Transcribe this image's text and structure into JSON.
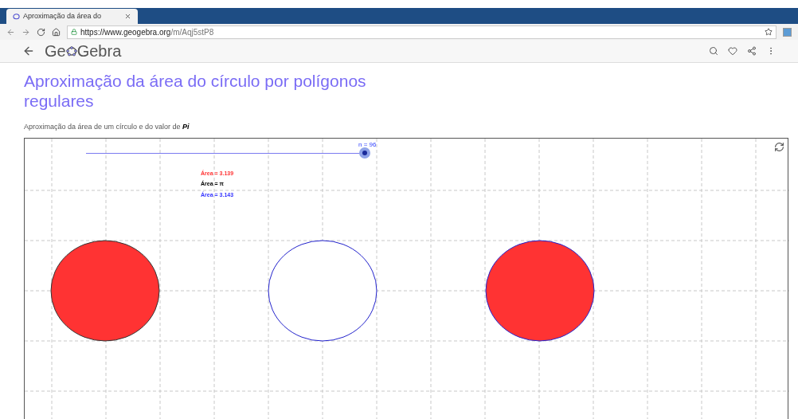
{
  "browser": {
    "tab_title": "Aproximação da área do",
    "url_host": "https://www.geogebra.org",
    "url_path": "/m/Aqj5stP8"
  },
  "site": {
    "logo_start": "Ge",
    "logo_end": "Gebra"
  },
  "title": "Aproximação da área do círculo por polígonos regulares",
  "subtitle": "Aproximação da área de um círculo e do valor de **Pi**",
  "applet": {
    "slider": {
      "label": "n = 96"
    },
    "labels": [
      {
        "text": "Área = 3.139",
        "color": "#ff3333"
      },
      {
        "text": "Área = π",
        "color": "#000000"
      },
      {
        "text": "Área = 3.143",
        "color": "#3333ff"
      }
    ],
    "circles": [
      {
        "kind": "polygon"
      },
      {
        "kind": "circle"
      },
      {
        "kind": "overlay"
      }
    ]
  }
}
